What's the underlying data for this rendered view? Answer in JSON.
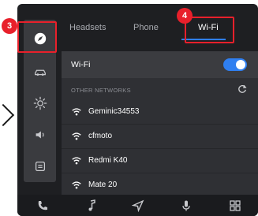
{
  "annotations": {
    "badge_sidebar": "3",
    "badge_tab": "4",
    "accent": "#e8202b"
  },
  "sidebar": {
    "items": [
      {
        "icon": "compass-icon",
        "active": true
      },
      {
        "icon": "car-icon",
        "active": false
      },
      {
        "icon": "brightness-icon",
        "active": false
      },
      {
        "icon": "volume-icon",
        "active": false
      },
      {
        "icon": "info-icon",
        "active": false
      }
    ]
  },
  "tabs": [
    {
      "label": "Headsets",
      "active": false
    },
    {
      "label": "Phone",
      "active": false
    },
    {
      "label": "Wi-Fi",
      "active": true
    }
  ],
  "wifi": {
    "label": "Wi-Fi",
    "enabled": true,
    "toggle_color": "#2f7ff0"
  },
  "networks": {
    "section_title": "OTHER NETWORKS",
    "items": [
      {
        "name": "Geminic34553"
      },
      {
        "name": "cfmoto"
      },
      {
        "name": "Redmi K40"
      },
      {
        "name": "Mate 20"
      }
    ]
  },
  "bottom_bar": {
    "icons": [
      "phone-icon",
      "music-icon",
      "navigation-icon",
      "microphone-icon",
      "grid-icon"
    ]
  }
}
